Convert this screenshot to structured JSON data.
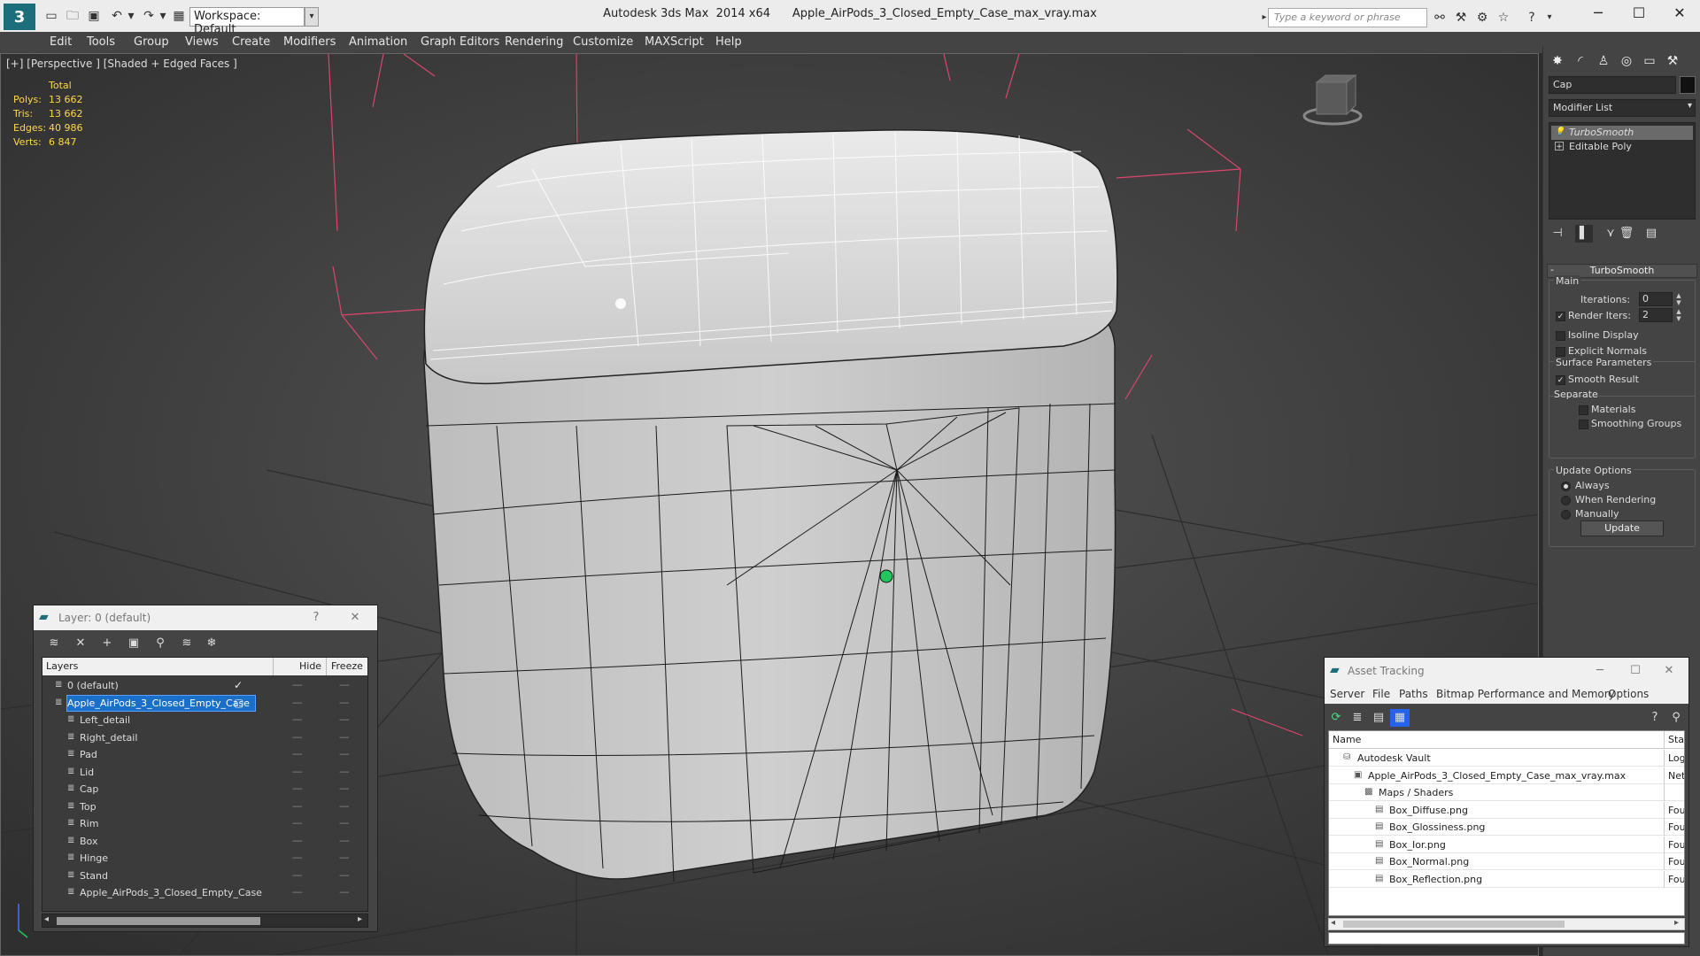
{
  "titlebar": {
    "app_logo": "3",
    "workspace": "Workspace: Default",
    "app_name": "Autodesk 3ds Max  2014 x64",
    "file_name": "Apple_AirPods_3_Closed_Empty_Case_max_vray.max",
    "search_placeholder": "Type a keyword or phrase"
  },
  "menu": [
    "Edit",
    "Tools",
    "Group",
    "Views",
    "Create",
    "Modifiers",
    "Animation",
    "Graph Editors",
    "Rendering",
    "Customize",
    "MAXScript",
    "Help"
  ],
  "viewport": {
    "label": "[+] [Perspective ] [Shaded + Edged Faces ]",
    "stats": {
      "total_label": "Total",
      "rows": [
        {
          "label": "Polys:",
          "value": "13 662"
        },
        {
          "label": "Tris:",
          "value": "13 662"
        },
        {
          "label": "Edges:",
          "value": "40 986"
        },
        {
          "label": "Verts:",
          "value": "6 847"
        }
      ]
    }
  },
  "command_panel": {
    "object_name": "Cap",
    "modifier_list": "Modifier List",
    "stack": [
      {
        "label": "TurboSmooth",
        "selected": true
      },
      {
        "label": "Editable Poly",
        "selected": false
      }
    ],
    "rollout_title": "TurboSmooth",
    "main_label": "Main",
    "iterations_label": "Iterations:",
    "iterations_value": "0",
    "render_iters_label": "Render Iters:",
    "render_iters_value": "2",
    "isoline_label": "Isoline Display",
    "explicit_normals_label": "Explicit Normals",
    "surface_params_label": "Surface Parameters",
    "smooth_result_label": "Smooth Result",
    "separate_label": "Separate",
    "materials_label": "Materials",
    "smoothing_groups_label": "Smoothing Groups",
    "update_options_label": "Update Options",
    "always_label": "Always",
    "when_rendering_label": "When Rendering",
    "manually_label": "Manually",
    "update_button": "Update"
  },
  "layer_dialog": {
    "title": "Layer: 0 (default)",
    "help": "?",
    "columns": {
      "layers": "Layers",
      "hide": "Hide",
      "freeze": "Freeze"
    },
    "rows": [
      {
        "name": "0 (default)",
        "indent": 0,
        "selected": false,
        "check": "✓"
      },
      {
        "name": "Apple_AirPods_3_Closed_Empty_Case",
        "indent": 0,
        "selected": true,
        "check": "▢"
      },
      {
        "name": "Left_detail",
        "indent": 1,
        "selected": false,
        "check": ""
      },
      {
        "name": "Right_detail",
        "indent": 1,
        "selected": false,
        "check": ""
      },
      {
        "name": "Pad",
        "indent": 1,
        "selected": false,
        "check": ""
      },
      {
        "name": "Lid",
        "indent": 1,
        "selected": false,
        "check": ""
      },
      {
        "name": "Cap",
        "indent": 1,
        "selected": false,
        "check": ""
      },
      {
        "name": "Top",
        "indent": 1,
        "selected": false,
        "check": ""
      },
      {
        "name": "Rim",
        "indent": 1,
        "selected": false,
        "check": ""
      },
      {
        "name": "Box",
        "indent": 1,
        "selected": false,
        "check": ""
      },
      {
        "name": "Hinge",
        "indent": 1,
        "selected": false,
        "check": ""
      },
      {
        "name": "Stand",
        "indent": 1,
        "selected": false,
        "check": ""
      },
      {
        "name": "Apple_AirPods_3_Closed_Empty_Case",
        "indent": 1,
        "selected": false,
        "check": ""
      }
    ]
  },
  "asset_dialog": {
    "title": "Asset Tracking",
    "menu": [
      "Server",
      "File",
      "Paths",
      "Bitmap Performance and Memory",
      "Options"
    ],
    "columns": {
      "name": "Name",
      "status": "Status"
    },
    "rows": [
      {
        "name": "Autodesk Vault",
        "indent": 1,
        "status": "Logged O",
        "icon": "vault-icon"
      },
      {
        "name": "Apple_AirPods_3_Closed_Empty_Case_max_vray.max",
        "indent": 2,
        "status": "Network",
        "icon": "max-file-icon"
      },
      {
        "name": "Maps / Shaders",
        "indent": 3,
        "status": "",
        "icon": "maps-icon"
      },
      {
        "name": "Box_Diffuse.png",
        "indent": 4,
        "status": "Found",
        "icon": "image-file-icon"
      },
      {
        "name": "Box_Glossiness.png",
        "indent": 4,
        "status": "Found",
        "icon": "image-file-icon"
      },
      {
        "name": "Box_Ior.png",
        "indent": 4,
        "status": "Found",
        "icon": "image-file-icon"
      },
      {
        "name": "Box_Normal.png",
        "indent": 4,
        "status": "Found",
        "icon": "image-file-icon"
      },
      {
        "name": "Box_Reflection.png",
        "indent": 4,
        "status": "Found",
        "icon": "image-file-icon"
      }
    ]
  },
  "colors": {
    "viewport_bg": "#474747",
    "stats_text": "#ffd84a",
    "selection_blue": "#1a6fc9",
    "helper_lines": "#d9476b",
    "brand": "#1b6e7a"
  }
}
